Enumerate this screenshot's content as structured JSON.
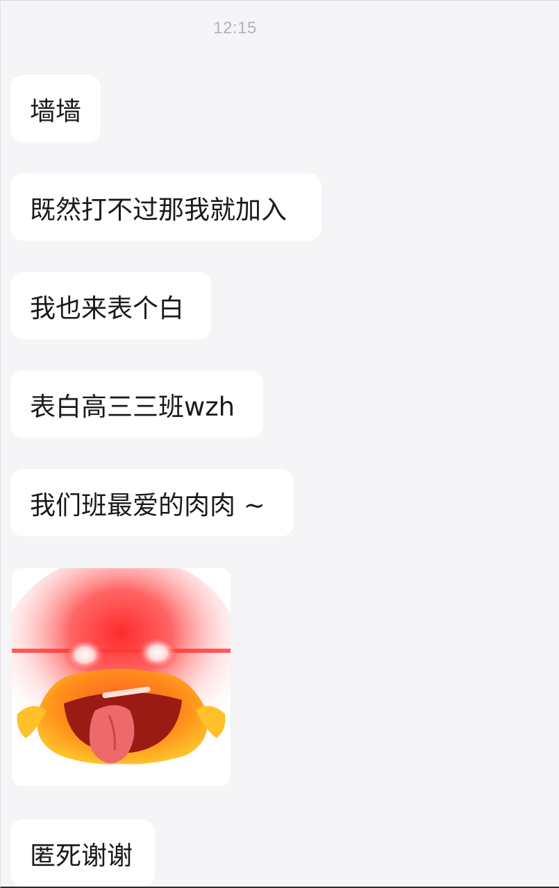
{
  "chat": {
    "timestamp": "12:15",
    "messages": [
      {
        "text": "墙墙"
      },
      {
        "text": "既然打不过那我就加入"
      },
      {
        "text": "我也来表个白"
      },
      {
        "text": "表白高三三班wzh"
      },
      {
        "text": "我们班最爱的肉肉 ~"
      },
      {
        "sticker": "angry-red-eyes-face-sticker"
      },
      {
        "text": "匿死谢谢"
      }
    ]
  },
  "colors": {
    "background": "#f5f4f7",
    "bubble": "#ffffff",
    "text": "#1a1a1a",
    "timestamp": "#b3b3b8"
  }
}
